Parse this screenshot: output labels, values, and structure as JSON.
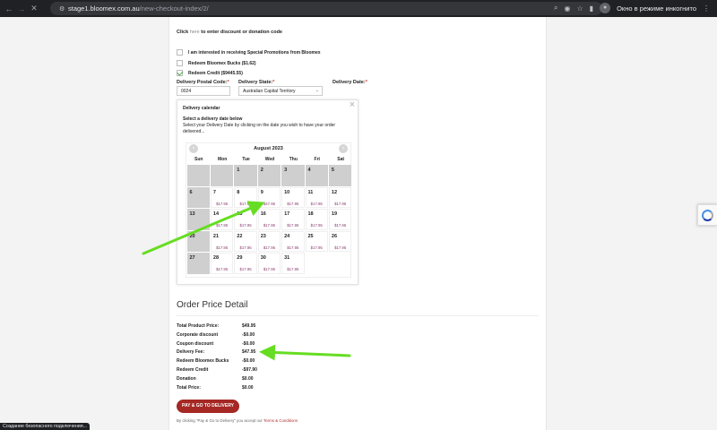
{
  "browser": {
    "host": "stage1.bloomex.com.au",
    "path": "/new-checkout-index/2/",
    "incognito_label": "Окно в режиме инкогнито"
  },
  "checkout": {
    "discount": {
      "prefix": "Click ",
      "link": "here",
      "suffix": " to enter discount or donation code"
    },
    "options": [
      {
        "label": "I am interested in receiving Special Promotions from Bloomex",
        "checked": false
      },
      {
        "label": "Redeem Bloomex Bucks ($1.62)",
        "checked": false
      },
      {
        "label": "Redeem Credit ($9445.55)",
        "checked": true
      }
    ],
    "postal_label": "Delivery Postal Code:",
    "postal_value": "0024",
    "state_label": "Delivery State:",
    "state_value": "Australian Capital Territory",
    "date_label": "Delivery Date:",
    "required_mark": "*"
  },
  "calendar": {
    "title": "Delivery calendar",
    "subtitle": "Select a delivery date below",
    "description": "Select your Delivery Date by clicking on the date you wish to have your order delivered...",
    "month": "August 2023",
    "weekdays": [
      "Sun",
      "Mon",
      "Tue",
      "Wed",
      "Thu",
      "Fri",
      "Sat"
    ],
    "weeks": [
      [
        {
          "d": "",
          "off": true
        },
        {
          "d": "",
          "off": true
        },
        {
          "d": "1",
          "off": true
        },
        {
          "d": "2",
          "off": true
        },
        {
          "d": "3",
          "off": true
        },
        {
          "d": "4",
          "off": true
        },
        {
          "d": "5",
          "off": true
        }
      ],
      [
        {
          "d": "6",
          "off": true
        },
        {
          "d": "7",
          "p": "$17.95"
        },
        {
          "d": "8",
          "p": "$17.95"
        },
        {
          "d": "9",
          "p": "$47.95"
        },
        {
          "d": "10",
          "p": "$17.95"
        },
        {
          "d": "11",
          "p": "$17.95"
        },
        {
          "d": "12",
          "p": "$17.95"
        }
      ],
      [
        {
          "d": "13",
          "off": true
        },
        {
          "d": "14",
          "p": "$17.95"
        },
        {
          "d": "15",
          "p": "$17.95"
        },
        {
          "d": "16",
          "p": "$17.95"
        },
        {
          "d": "17",
          "p": "$17.95"
        },
        {
          "d": "18",
          "p": "$17.95"
        },
        {
          "d": "19",
          "p": "$17.95"
        }
      ],
      [
        {
          "d": "20",
          "off": true
        },
        {
          "d": "21",
          "p": "$17.95"
        },
        {
          "d": "22",
          "p": "$17.95"
        },
        {
          "d": "23",
          "p": "$17.95"
        },
        {
          "d": "24",
          "p": "$17.95"
        },
        {
          "d": "25",
          "p": "$17.95"
        },
        {
          "d": "26",
          "p": "$17.95"
        }
      ],
      [
        {
          "d": "27",
          "off": true
        },
        {
          "d": "28",
          "p": "$17.95"
        },
        {
          "d": "29",
          "p": "$17.95"
        },
        {
          "d": "30",
          "p": "$17.95"
        },
        {
          "d": "31",
          "p": "$17.95"
        }
      ]
    ]
  },
  "order": {
    "title": "Order Price Detail",
    "rows": [
      {
        "label": "Total Product Price:",
        "value": "$49.95"
      },
      {
        "label": "Corporate discount",
        "value": "-$0.00"
      },
      {
        "label": "Coupon discount",
        "value": "-$0.00"
      },
      {
        "label": "Delivery Fee:",
        "value": "$47.95"
      },
      {
        "label": "Redeem Bloomex Bucks",
        "value": "-$0.00"
      },
      {
        "label": "Redeem Credit",
        "value": "-$97.90"
      },
      {
        "label": "Donation",
        "value": "$0.00"
      },
      {
        "label": "Total Price:",
        "value": "$0.00"
      }
    ],
    "pay_button": "PAY & GO TO DELIVERY",
    "terms_prefix": "By clicking \"Pay & Go to Delivery\" you accept our ",
    "terms_link": "Terms & Conditions"
  },
  "status_bar": "Создание безопасного подключения...",
  "colors": {
    "pay_button": "#a52824",
    "annotation_arrow": "#66dd22",
    "price_text": "#8a3b6e"
  }
}
